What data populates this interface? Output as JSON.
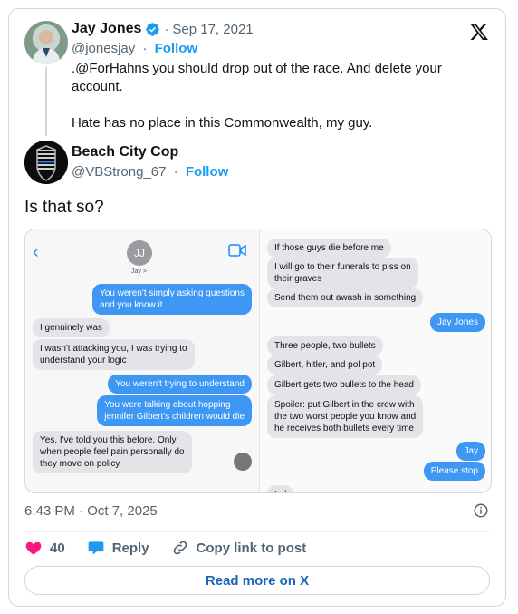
{
  "colors": {
    "accent": "#1d9bf0",
    "like": "#f91880",
    "imessage_blue": "#3d97f3"
  },
  "tweet": {
    "author_name": "Jay Jones",
    "verified": true,
    "date": "Sep 17, 2021",
    "handle": "@jonesjay",
    "follow": "Follow",
    "text_p1": ".@ForHahns you should drop out of the race. And delete your account.",
    "text_p2": "Hate has no place in this Commonwealth, my guy."
  },
  "reply": {
    "author_name": "Beach City Cop",
    "handle": "@VBStrong_67",
    "follow": "Follow",
    "text": "Is that so?"
  },
  "media": {
    "left": {
      "contact_initials": "JJ",
      "contact_name": "Jay >",
      "messages": [
        {
          "from": "sent",
          "text": "You weren't simply asking questions\nand you know it"
        },
        {
          "from": "received",
          "text": "I genuinely was"
        },
        {
          "from": "received",
          "text": "I wasn't attacking you, I was trying to\nunderstand your logic"
        },
        {
          "from": "sent",
          "text": "You weren't trying to understand"
        },
        {
          "from": "sent",
          "text": "You were talking about hopping\njennifer Gilbert's children would die"
        },
        {
          "from": "received",
          "text": "Yes, I've told you this before. Only\nwhen people feel pain personally do\nthey move on policy"
        }
      ]
    },
    "right": {
      "messages": [
        {
          "from": "received",
          "text": "If those guys die before me"
        },
        {
          "from": "received",
          "text": "I will go to their funerals to piss on\ntheir graves"
        },
        {
          "from": "received",
          "text": "Send them out awash in something"
        },
        {
          "from": "sent",
          "text": "Jay Jones"
        },
        {
          "from": "received",
          "text": "Three people, two bullets"
        },
        {
          "from": "received",
          "text": "Gilbert, hitler, and pol pot"
        },
        {
          "from": "received",
          "text": "Gilbert gets two bullets to the head"
        },
        {
          "from": "received",
          "text": "Spoiler: put Gilbert in the crew with\nthe two worst people you know and\nhe receives both bullets every time"
        },
        {
          "from": "sent",
          "text": "Jay"
        },
        {
          "from": "sent",
          "text": "Please stop"
        },
        {
          "from": "received",
          "text": "Lol"
        }
      ]
    }
  },
  "footer": {
    "timestamp": "6:43 PM · Oct 7, 2025",
    "likes": "40",
    "reply_label": "Reply",
    "copy_label": "Copy link to post",
    "read_more": "Read more on X"
  },
  "icons": [
    "verified-icon",
    "x-logo-icon",
    "back-chevron-icon",
    "video-call-icon",
    "info-icon",
    "heart-icon",
    "reply-icon",
    "link-icon"
  ]
}
